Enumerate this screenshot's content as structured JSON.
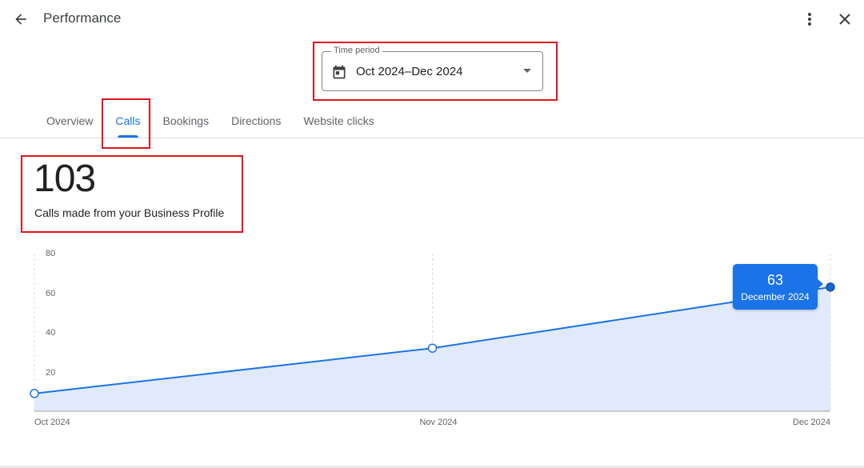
{
  "header": {
    "title": "Performance",
    "back_icon": "arrow-back-icon",
    "more_icon": "more-vert-icon",
    "close_icon": "close-icon"
  },
  "time_period": {
    "label": "Time period",
    "value": "Oct 2024–Dec 2024",
    "icon": "calendar-icon"
  },
  "tabs": [
    {
      "label": "Overview",
      "active": false
    },
    {
      "label": "Calls",
      "active": true
    },
    {
      "label": "Bookings",
      "active": false
    },
    {
      "label": "Directions",
      "active": false
    },
    {
      "label": "Website clicks",
      "active": false
    }
  ],
  "metric": {
    "value": "103",
    "caption": "Calls made from your Business Profile"
  },
  "tooltip": {
    "value": "63",
    "label": "December 2024"
  },
  "colors": {
    "accent": "#1a73e8",
    "highlight": "#e0141e",
    "area_fill": "#e1eafb"
  },
  "chart_data": {
    "type": "area",
    "categories": [
      "Oct 2024",
      "Nov 2024",
      "Dec 2024"
    ],
    "values": [
      9,
      32,
      63
    ],
    "ylim": [
      0,
      80
    ],
    "yticks": [
      "20",
      "40",
      "60",
      "80"
    ],
    "grid": true
  }
}
